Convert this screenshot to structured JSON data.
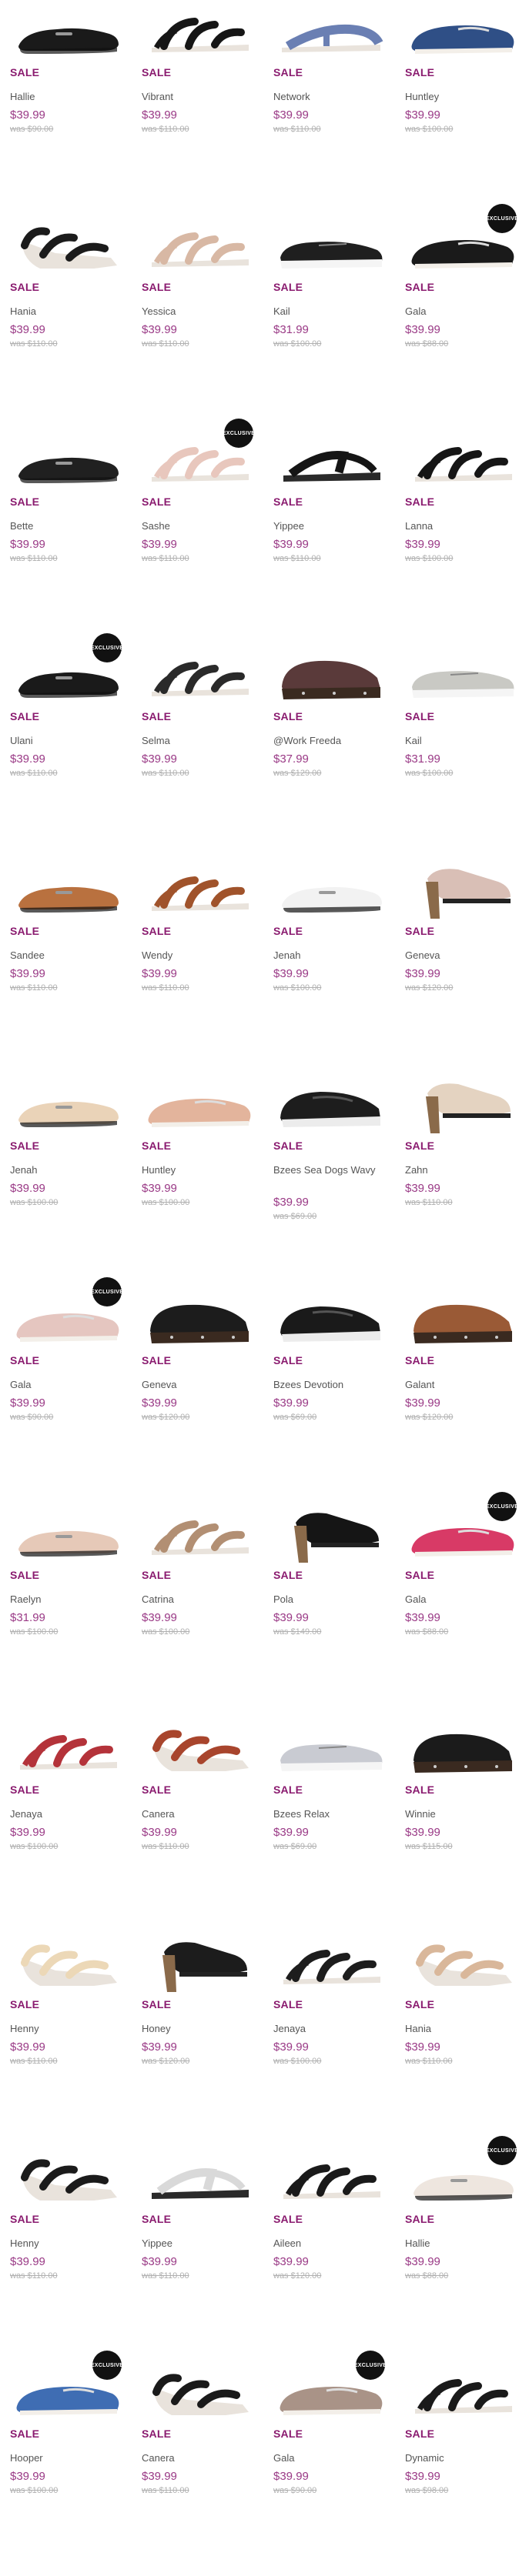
{
  "sale_label": "SALE",
  "exclusive_label": "EXCLUSIVE",
  "colors": {
    "sale": "#8a1b6f",
    "price": "#9a3a86",
    "was": "#b0b0b0"
  },
  "rows": [
    [
      {
        "name": "Hallie",
        "price": "$39.99",
        "was": "was $90.00",
        "shoe": "flat",
        "color": "#1a1a1a",
        "exclusive": false
      },
      {
        "name": "Vibrant",
        "price": "$39.99",
        "was": "was $110.00",
        "shoe": "sandal",
        "color": "#161616",
        "exclusive": false
      },
      {
        "name": "Network",
        "price": "$39.99",
        "was": "was $110.00",
        "shoe": "tsandal",
        "color": "#6a7fb3",
        "exclusive": false
      },
      {
        "name": "Huntley",
        "price": "$39.99",
        "was": "was $100.00",
        "shoe": "loafer",
        "color": "#2f4f86",
        "exclusive": false
      }
    ],
    [
      {
        "name": "Hania",
        "price": "$39.99",
        "was": "was $110.00",
        "shoe": "wedge",
        "color": "#1b1b1b",
        "exclusive": false
      },
      {
        "name": "Yessica",
        "price": "$39.99",
        "was": "was $110.00",
        "shoe": "sandal",
        "color": "#d8b8a4",
        "exclusive": false
      },
      {
        "name": "Kail",
        "price": "$31.99",
        "was": "was $100.00",
        "shoe": "sneaker",
        "color": "#1f1f1f",
        "exclusive": false
      },
      {
        "name": "Gala",
        "price": "$39.99",
        "was": "was $88.00",
        "shoe": "loafer",
        "color": "#1a1a1a",
        "exclusive": true
      }
    ],
    [
      {
        "name": "Bette",
        "price": "$39.99",
        "was": "was $110.00",
        "shoe": "flat",
        "color": "#202020",
        "exclusive": false
      },
      {
        "name": "Sashe",
        "price": "$39.99",
        "was": "was $110.00",
        "shoe": "sandal",
        "color": "#e8c7bd",
        "exclusive": true
      },
      {
        "name": "Yippee",
        "price": "$39.99",
        "was": "was $110.00",
        "shoe": "thong",
        "color": "#151515",
        "exclusive": false
      },
      {
        "name": "Lanna",
        "price": "$39.99",
        "was": "was $100.00",
        "shoe": "sandal",
        "color": "#161616",
        "exclusive": false
      }
    ],
    [
      {
        "name": "Ulani",
        "price": "$39.99",
        "was": "was $110.00",
        "shoe": "flat",
        "color": "#1a1a1a",
        "exclusive": true
      },
      {
        "name": "Selma",
        "price": "$39.99",
        "was": "was $110.00",
        "shoe": "sandal",
        "color": "#2a2a2a",
        "exclusive": false
      },
      {
        "name": "@Work Freeda",
        "price": "$37.99",
        "was": "was $129.00",
        "shoe": "clog",
        "color": "#5a3a3a",
        "exclusive": false
      },
      {
        "name": "Kail",
        "price": "$31.99",
        "was": "was $100.00",
        "shoe": "sneaker",
        "color": "#c9c9c4",
        "exclusive": false
      }
    ],
    [
      {
        "name": "Sandee",
        "price": "$39.99",
        "was": "was $110.00",
        "shoe": "flat",
        "color": "#b9713f",
        "exclusive": false
      },
      {
        "name": "Wendy",
        "price": "$39.99",
        "was": "was $110.00",
        "shoe": "sandal",
        "color": "#a0532b",
        "exclusive": false
      },
      {
        "name": "Jenah",
        "price": "$39.99",
        "was": "was $100.00",
        "shoe": "flat",
        "color": "#f2f2f2",
        "exclusive": false
      },
      {
        "name": "Geneva",
        "price": "$39.99",
        "was": "was $120.00",
        "shoe": "heel",
        "color": "#d9bfb6",
        "exclusive": false
      }
    ],
    [
      {
        "name": "Jenah",
        "price": "$39.99",
        "was": "was $100.00",
        "shoe": "flat",
        "color": "#ead3b8",
        "exclusive": false
      },
      {
        "name": "Huntley",
        "price": "$39.99",
        "was": "was $100.00",
        "shoe": "loafer",
        "color": "#e3b49c",
        "exclusive": false
      },
      {
        "name": "Bzees Sea Dogs Wavy",
        "price": "$39.99",
        "was": "was $69.00",
        "shoe": "slipon",
        "color": "#1d1d1d",
        "exclusive": false
      },
      {
        "name": "Zahn",
        "price": "$39.99",
        "was": "was $110.00",
        "shoe": "heel",
        "color": "#e4d3c1",
        "exclusive": false
      }
    ],
    [
      {
        "name": "Gala",
        "price": "$39.99",
        "was": "was $90.00",
        "shoe": "loafer",
        "color": "#e5c6c0",
        "exclusive": true
      },
      {
        "name": "Geneva",
        "price": "$39.99",
        "was": "was $120.00",
        "shoe": "clog",
        "color": "#1c1c1c",
        "exclusive": false
      },
      {
        "name": "Bzees Devotion",
        "price": "$39.99",
        "was": "was $69.00",
        "shoe": "slipon",
        "color": "#1a1a1a",
        "exclusive": false
      },
      {
        "name": "Galant",
        "price": "$39.99",
        "was": "was $120.00",
        "shoe": "clog",
        "color": "#9a5a36",
        "exclusive": false
      }
    ],
    [
      {
        "name": "Raelyn",
        "price": "$31.99",
        "was": "was $100.00",
        "shoe": "flat",
        "color": "#e6c9b8",
        "exclusive": false
      },
      {
        "name": "Catrina",
        "price": "$39.99",
        "was": "was $100.00",
        "shoe": "sandal",
        "color": "#b28f73",
        "exclusive": false
      },
      {
        "name": "Pola",
        "price": "$39.99",
        "was": "was $149.00",
        "shoe": "heel",
        "color": "#151515",
        "exclusive": false
      },
      {
        "name": "Gala",
        "price": "$39.99",
        "was": "was $88.00",
        "shoe": "loafer",
        "color": "#d83a66",
        "exclusive": true
      }
    ],
    [
      {
        "name": "Jenaya",
        "price": "$39.99",
        "was": "was $100.00",
        "shoe": "sandal",
        "color": "#b4333a",
        "exclusive": false
      },
      {
        "name": "Canera",
        "price": "$39.99",
        "was": "was $110.00",
        "shoe": "wedge",
        "color": "#a8452d",
        "exclusive": false
      },
      {
        "name": "Bzees Relax",
        "price": "$39.99",
        "was": "was $69.00",
        "shoe": "sneaker",
        "color": "#c9cbd2",
        "exclusive": false
      },
      {
        "name": "Winnie",
        "price": "$39.99",
        "was": "was $115.00",
        "shoe": "clog",
        "color": "#1b1b1b",
        "exclusive": false
      }
    ],
    [
      {
        "name": "Henny",
        "price": "$39.99",
        "was": "was $110.00",
        "shoe": "wedge",
        "color": "#ecd8b7",
        "exclusive": false
      },
      {
        "name": "Honey",
        "price": "$39.99",
        "was": "was $120.00",
        "shoe": "heel",
        "color": "#1c1c1c",
        "exclusive": false
      },
      {
        "name": "Jenaya",
        "price": "$39.99",
        "was": "was $100.00",
        "shoe": "sandal",
        "color": "#1d1d1d",
        "exclusive": false
      },
      {
        "name": "Hania",
        "price": "$39.99",
        "was": "was $110.00",
        "shoe": "wedge",
        "color": "#d9b79a",
        "exclusive": false
      }
    ],
    [
      {
        "name": "Henny",
        "price": "$39.99",
        "was": "was $110.00",
        "shoe": "wedge",
        "color": "#1b1b1b",
        "exclusive": false
      },
      {
        "name": "Yippee",
        "price": "$39.99",
        "was": "was $110.00",
        "shoe": "thong",
        "color": "#d9d9d9",
        "exclusive": false
      },
      {
        "name": "Aileen",
        "price": "$39.99",
        "was": "was $120.00",
        "shoe": "sandal",
        "color": "#1a1a1a",
        "exclusive": false
      },
      {
        "name": "Hallie",
        "price": "$39.99",
        "was": "was $88.00",
        "shoe": "flat",
        "color": "#eee6df",
        "exclusive": true
      }
    ],
    [
      {
        "name": "Hooper",
        "price": "$39.99",
        "was": "was $100.00",
        "shoe": "loafer",
        "color": "#3f6db3",
        "exclusive": true
      },
      {
        "name": "Canera",
        "price": "$39.99",
        "was": "was $110.00",
        "shoe": "wedge",
        "color": "#1a1a1a",
        "exclusive": false
      },
      {
        "name": "Gala",
        "price": "$39.99",
        "was": "was $90.00",
        "shoe": "loafer",
        "color": "#a99387",
        "exclusive": true
      },
      {
        "name": "Dynamic",
        "price": "$39.99",
        "was": "was $98.00",
        "shoe": "sandal",
        "color": "#1a1a1a",
        "exclusive": false
      }
    ]
  ]
}
